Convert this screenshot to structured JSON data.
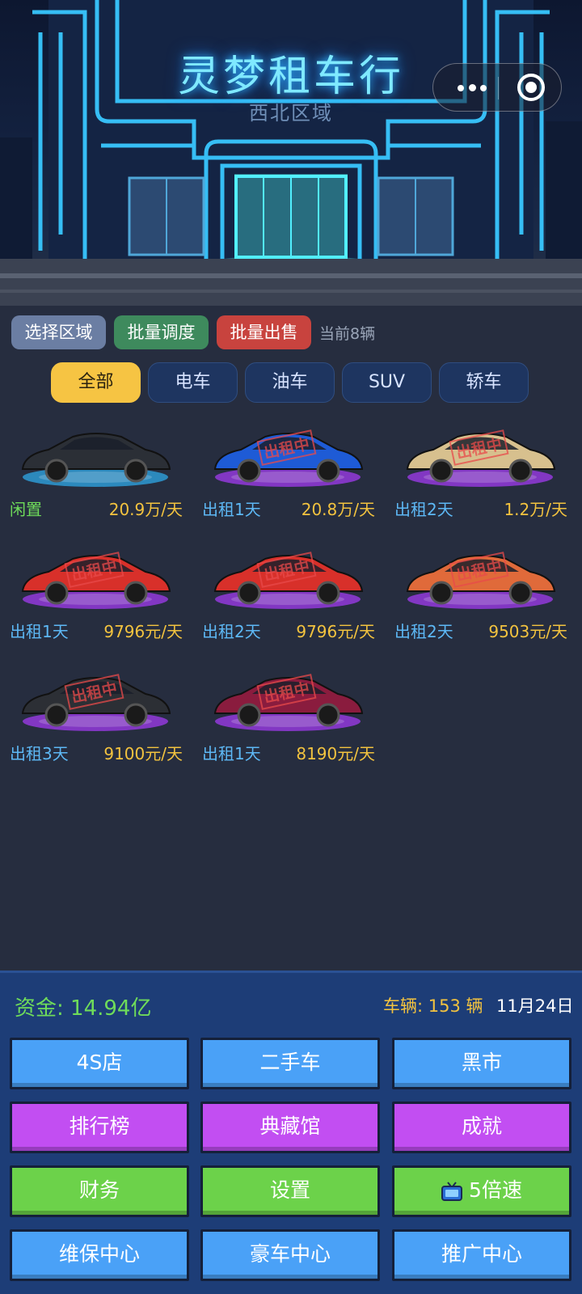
{
  "header": {
    "title": "灵梦租车行",
    "subtitle": "西北区域"
  },
  "toolbar": {
    "select_region": "选择区域",
    "batch_dispatch": "批量调度",
    "batch_sell": "批量出售",
    "vehicle_count": "当前8辆"
  },
  "tabs": [
    {
      "label": "全部",
      "active": true
    },
    {
      "label": "电车",
      "active": false
    },
    {
      "label": "油车",
      "active": false
    },
    {
      "label": "SUV",
      "active": false
    },
    {
      "label": "轿车",
      "active": false
    }
  ],
  "cars": [
    {
      "status": "闲置",
      "price": "20.9万/天",
      "color": "#2b2f36",
      "rented": false
    },
    {
      "status": "出租1天",
      "price": "20.8万/天",
      "color": "#1e5bd6",
      "rented": true
    },
    {
      "status": "出租2天",
      "price": "1.2万/天",
      "color": "#d7c08e",
      "rented": true
    },
    {
      "status": "出租1天",
      "price": "9796元/天",
      "color": "#d8302a",
      "rented": true
    },
    {
      "status": "出租2天",
      "price": "9796元/天",
      "color": "#d8302a",
      "rented": true
    },
    {
      "status": "出租2天",
      "price": "9503元/天",
      "color": "#e06a3a",
      "rented": true
    },
    {
      "status": "出租3天",
      "price": "9100元/天",
      "color": "#2c2f35",
      "rented": true
    },
    {
      "status": "出租1天",
      "price": "8190元/天",
      "color": "#8a1c3e",
      "rented": true
    }
  ],
  "rented_stamp": "出租中",
  "stats": {
    "funds": "资金: 14.94亿",
    "vehicles": "车辆: 153 辆",
    "date": "11月24日"
  },
  "menu": {
    "row1": [
      "4S店",
      "二手车",
      "黑市"
    ],
    "row2": [
      "排行榜",
      "典藏馆",
      "成就"
    ],
    "row3": [
      "财务",
      "设置",
      "5倍速"
    ],
    "row4": [
      "维保中心",
      "豪车中心",
      "推广中心"
    ]
  },
  "icons": {
    "speed_button_icon": "tv-icon",
    "capsule_more": "more-dots-icon",
    "capsule_close": "target-icon"
  }
}
